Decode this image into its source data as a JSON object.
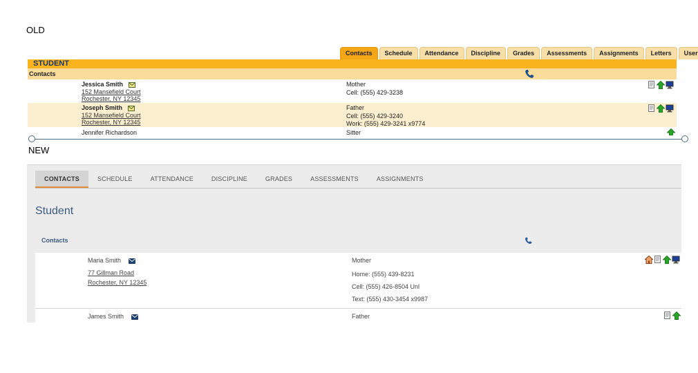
{
  "old": {
    "label": "OLD",
    "tabs": [
      "Contacts",
      "Schedule",
      "Attendance",
      "Discipline",
      "Grades",
      "Assessments",
      "Assignments",
      "Letters",
      "User Defined"
    ],
    "active_tab": "Contacts",
    "section_title": "STUDENT",
    "contacts_label": "Contacts",
    "rows": [
      {
        "name": "Jessica  Smith",
        "address1": "152 Mansefield Court",
        "address2": "Rochester, NY 12345",
        "relation": "Mother",
        "phones": [
          "Cell: (555) 429-3238"
        ]
      },
      {
        "name": "Joseph  Smith",
        "address1": "152 Mansefield Court",
        "address2": "Rochester, NY 12345",
        "relation": "Father",
        "phones": [
          "Cell: (555) 429-3240",
          "Work: (555) 429-3241 x9774"
        ]
      },
      {
        "name": "Jennifer  Richardson",
        "relation": "Sitter"
      }
    ]
  },
  "new": {
    "label": "NEW",
    "tabs": [
      "CONTACTS",
      "SCHEDULE",
      "ATTENDANCE",
      "DISCIPLINE",
      "GRADES",
      "ASSESSMENTS",
      "ASSIGNMENTS"
    ],
    "active_tab": "CONTACTS",
    "section_title": "Student",
    "contacts_label": "Contacts",
    "rows": [
      {
        "name": "Maria  Smith",
        "address1": "77 Gillman Road",
        "address2": "Rochester, NY 12345",
        "relation": "Mother",
        "phones": [
          "Home: (555) 439-8231",
          "Cell: (555) 426-8504 Unl",
          "Text: (555) 430-3454 x9987"
        ]
      },
      {
        "name": "James  Smith",
        "relation": "Father"
      }
    ]
  },
  "colors": {
    "old_orange": "#f9b31c",
    "old_light": "#f9dc99",
    "new_accent": "#e08a3a",
    "new_blue": "#3b5a80"
  }
}
